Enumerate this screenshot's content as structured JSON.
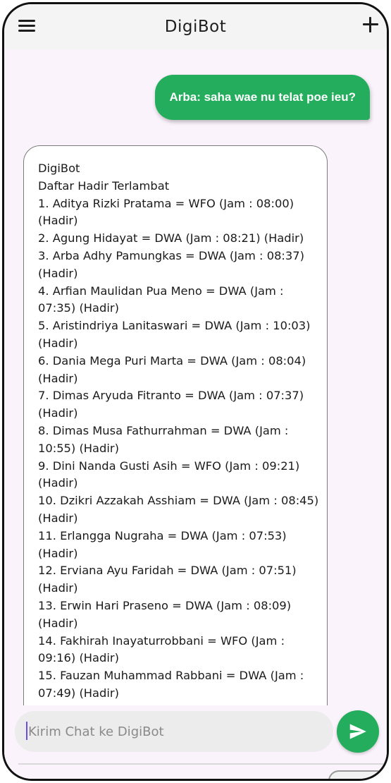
{
  "app": {
    "title": "DigiBot"
  },
  "icons": {
    "menu": "hamburger-menu-icon",
    "new_chat": "plus-icon",
    "send": "send-icon"
  },
  "colors": {
    "accent": "#23ad5c",
    "background": "#fbf3fb",
    "appbar": "#f4f4f4"
  },
  "messages": {
    "user": {
      "text": "Arba: saha wae nu telat poe ieu?"
    },
    "bot": {
      "lines": [
        "DigiBot",
        "Daftar Hadir Terlambat",
        "1. Aditya Rizki Pratama = WFO (Jam : 08:00)",
        "(Hadir)",
        "2. Agung Hidayat = DWA (Jam : 08:21) (Hadir)",
        "3. Arba Adhy Pamungkas = DWA (Jam : 08:37)",
        "(Hadir)",
        "4. Arfian Maulidan Pua Meno = DWA (Jam :",
        "07:35) (Hadir)",
        "5. Aristindriya Lanitaswari = DWA (Jam : 10:03)",
        "(Hadir)",
        "6. Dania Mega Puri Marta = DWA (Jam : 08:04)",
        "(Hadir)",
        "7. Dimas Aryuda Fitranto = DWA (Jam : 07:37)",
        "(Hadir)",
        "8. Dimas Musa Fathurrahman = DWA (Jam :",
        "10:55) (Hadir)",
        "9. Dini Nanda Gusti Asih = WFO (Jam : 09:21)",
        "(Hadir)",
        "10. Dzikri Azzakah Asshiam = DWA (Jam : 08:45)",
        "(Hadir)",
        "11. Erlangga Nugraha = DWA (Jam : 07:53)",
        "(Hadir)",
        "12. Erviana Ayu Faridah = DWA (Jam : 07:51)",
        "(Hadir)",
        "13. Erwin Hari Praseno = DWA (Jam : 08:09)",
        "(Hadir)",
        "14. Fakhirah Inayaturrobbani = WFO (Jam :",
        "09:16) (Hadir)",
        "15. Fauzan Muhammad Rabbani = DWA (Jam :",
        "07:49) (Hadir)"
      ]
    }
  },
  "input": {
    "placeholder": "Kirim Chat ke DigiBot",
    "value": ""
  }
}
